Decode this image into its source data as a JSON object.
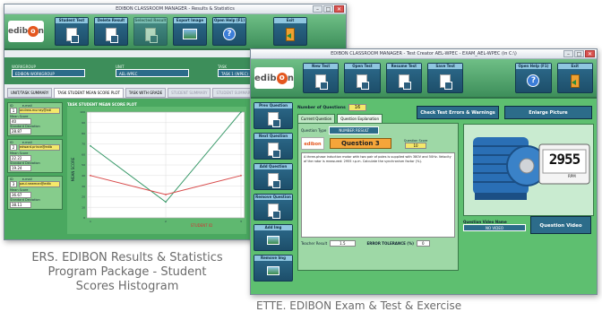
{
  "results_window": {
    "title": "EDIBON CLASSROOM MANAGER - Results & Statistics",
    "toolbar": [
      "Student Test",
      "Delete Result",
      "Selected Result",
      "Export Image",
      "Open Help (F1)",
      "Exit"
    ],
    "filters": [
      {
        "label": "WORKGROUP",
        "value": "EDIBON WORKGROUP"
      },
      {
        "label": "UNIT",
        "value": "AEL-WPEC"
      },
      {
        "label": "TASK",
        "value": "TASK 1 (WPEC)"
      }
    ],
    "tabs": [
      "UNIT/TASK SUMMARY",
      "TASK STUDENT MEAN SCORE PLOT",
      "TASK WITH GRADE",
      "STUDENT SUMMARY",
      "STUDENT SUMMARY"
    ],
    "students": [
      {
        "id_label": "ID",
        "email_label": "e-mail",
        "id": "1",
        "email": "andrew.murray@edi",
        "stats": [
          {
            "k": "Mean Score",
            "v": "40"
          },
          {
            "k": "Standard Deviation",
            "v": "28.87"
          }
        ]
      },
      {
        "id_label": "ID",
        "email_label": "e-mail",
        "id": "2",
        "email": "edward.prince@edib",
        "stats": [
          {
            "k": "Mean Score",
            "v": "22.22"
          },
          {
            "k": "Standard Deviation",
            "v": "19.24"
          }
        ]
      },
      {
        "id_label": "ID",
        "email_label": "e-mail",
        "id": "3",
        "email": "paul.newman@edib",
        "stats": [
          {
            "k": "Mean Score",
            "v": "36.67"
          },
          {
            "k": "Standard Deviation",
            "v": "38.11"
          }
        ]
      }
    ],
    "plot_title": "TASK STUDENT MEAN SCORE PLOT",
    "plot_ylabel": "MEAN SCORE",
    "plot_xlabel": "STUDENT ID",
    "chart_data": {
      "type": "line",
      "x": [
        1,
        2,
        3
      ],
      "ylim": [
        0,
        100
      ],
      "series": [
        {
          "color": "#3a9a6a",
          "values": [
            68,
            15,
            100
          ]
        },
        {
          "color": "#d84a4a",
          "values": [
            40,
            22,
            40
          ]
        }
      ]
    }
  },
  "test_window": {
    "title": "EDIBON CLASSROOM MANAGER - Test Creator AEL-WPEC - EXAM_AEL-WPEC (in C:\\)",
    "toolbar": [
      "New Test",
      "Open Test",
      "Resume Test",
      "Save Test",
      "Open Help (F1)",
      "Exit"
    ],
    "side_buttons": [
      "Prev Question",
      "Next Question",
      "Add Question",
      "Remove Question",
      "Add Img",
      "Remove Img"
    ],
    "num_questions_label": "Number of Questions",
    "num_questions": "16",
    "tabs": [
      "Current Question",
      "Question Explanation"
    ],
    "check_label": "Check Test Errors & Warnings",
    "enlarge_label": "Enlarge Picture",
    "qtype_label": "Question Type",
    "qtype_value": "NUMBER RESULT",
    "question_label": "Question 3",
    "score_label": "Question Score",
    "score_value": "10",
    "question_text": "A three-phase induction motor with two pair of poles is supplied with 380V and 50Hz. Velocity of the rotor is measured: 2955 r.p.m. Calculate the synchronism factor (%).",
    "teacher_label": "Teacher Result",
    "teacher_value": "1.5",
    "tolerance_label": "ERROR TOLERANCE (%)",
    "tolerance_value": "0",
    "video_label": "Question Video Name",
    "video_value": "NO VIDEO",
    "video_button": "Question Video",
    "display_value": "2955",
    "display_unit": "RPM"
  },
  "caption_left": [
    "ERS. EDIBON Results & Statistics",
    "Program Package - Student",
    "Scores Histogram"
  ],
  "caption_right": "ETTE. EDIBON Exam & Test & Exercise"
}
